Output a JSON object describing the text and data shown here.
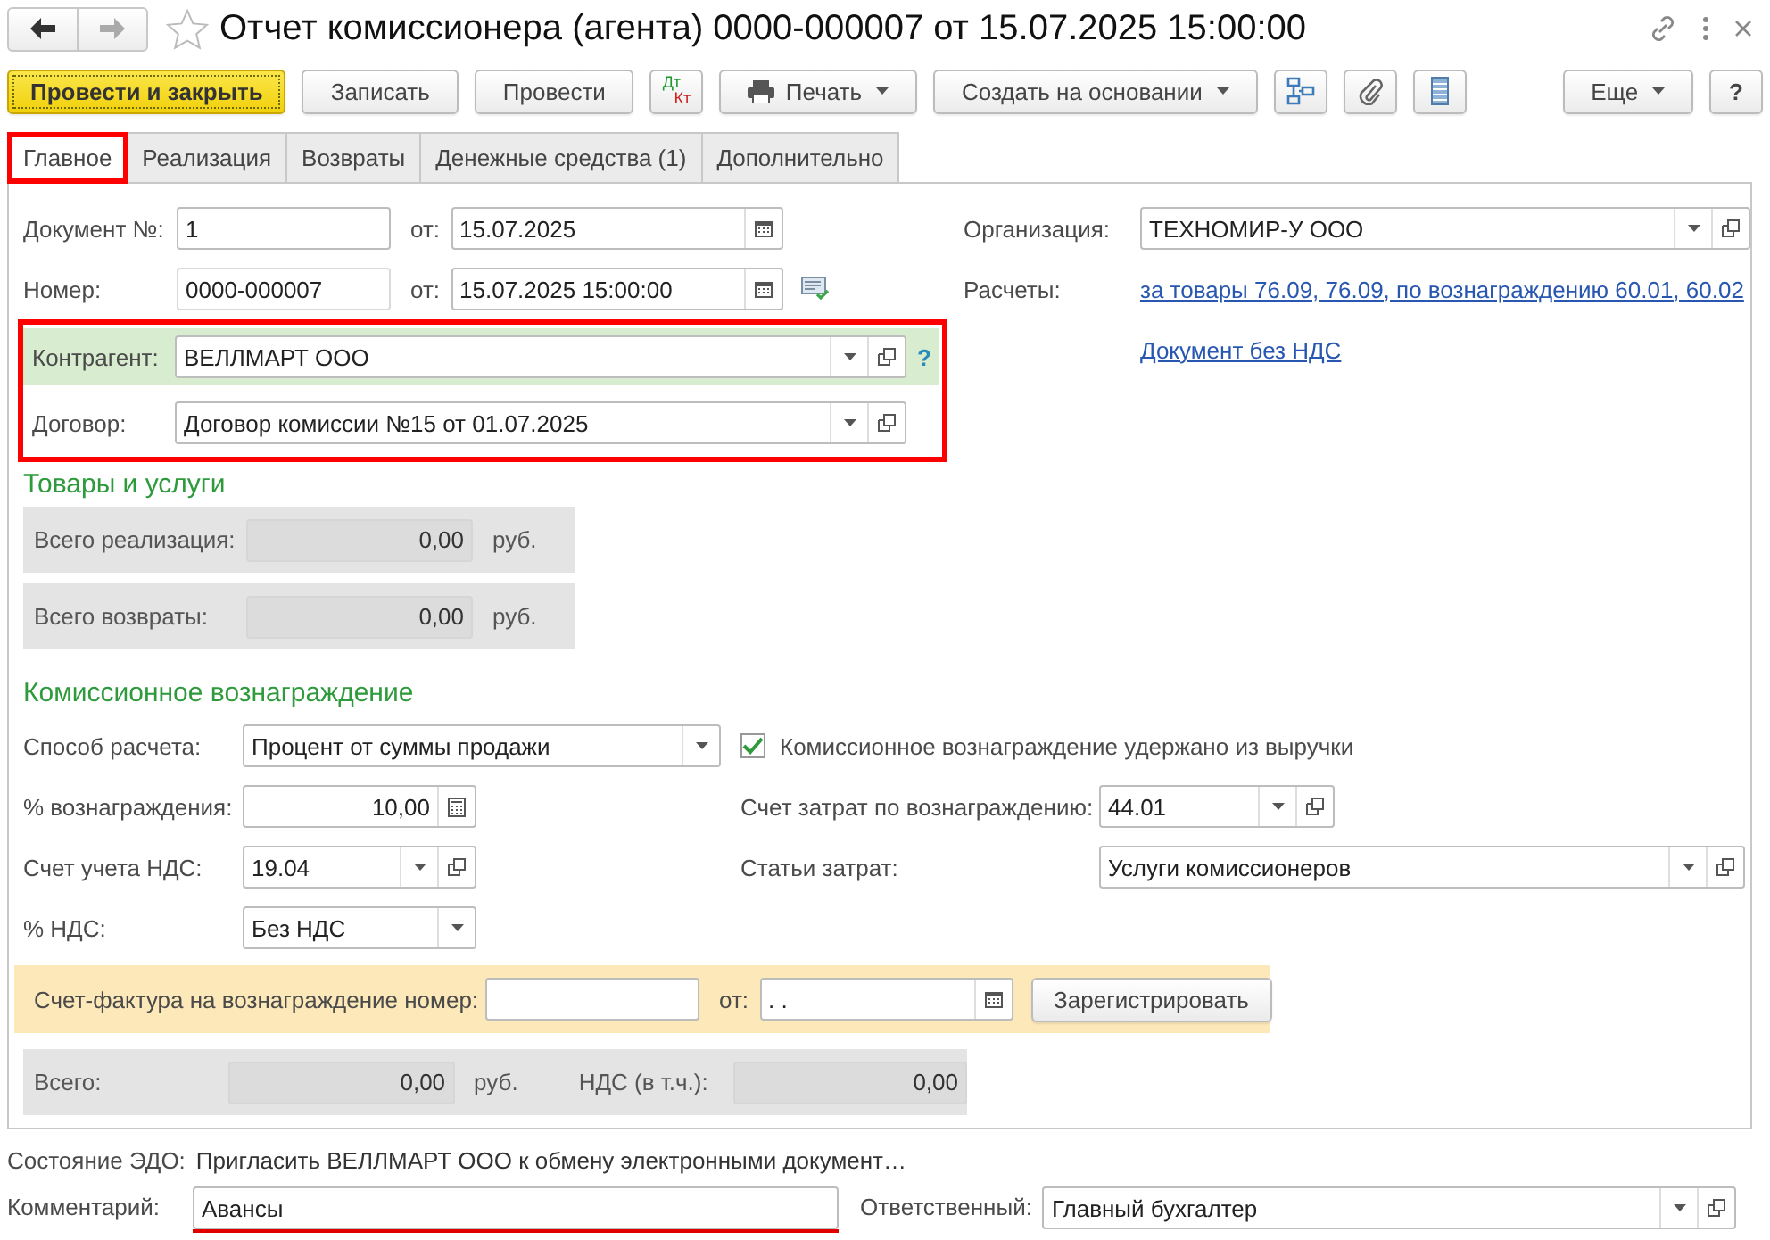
{
  "window": {
    "title": "Отчет комиссионера (агента) 0000-000007 от 15.07.2025 15:00:00",
    "favorite": false
  },
  "toolbar": {
    "left": [
      {
        "kind": "primary",
        "label": "Провести и закрыть"
      },
      {
        "kind": "plain",
        "label": "Записать"
      },
      {
        "kind": "plain",
        "label": "Провести"
      },
      {
        "kind": "dtkt",
        "top": "Дт",
        "bottom": "Кт"
      },
      {
        "kind": "print-menu",
        "label": "Печать"
      },
      {
        "kind": "menu",
        "label": "Создать на основании"
      },
      {
        "kind": "structure"
      },
      {
        "kind": "attach"
      },
      {
        "kind": "report"
      }
    ],
    "right": [
      {
        "kind": "menu",
        "label": "Еще"
      },
      {
        "kind": "plain",
        "label": "?"
      }
    ]
  },
  "tabs": [
    {
      "label": "Главное",
      "selected": true,
      "highlighted": true
    },
    {
      "label": "Реализация",
      "selected": false,
      "highlighted": false
    },
    {
      "label": "Возвраты",
      "selected": false,
      "highlighted": false
    },
    {
      "label": "Денежные средства (1)",
      "selected": false,
      "highlighted": false
    },
    {
      "label": "Дополнительно",
      "selected": false,
      "highlighted": false
    }
  ],
  "header": {
    "doc_number": {
      "label": "Документ №:",
      "value": "1",
      "date_label": "от:",
      "date": {
        "value": "15.07.2025",
        "kind": "date"
      }
    },
    "number": {
      "label": "Номер:",
      "value": "0000-000007",
      "readonly": true,
      "date_label": "от:",
      "date": {
        "value": "15.07.2025 15:00:00",
        "kind": "date"
      }
    },
    "parties": {
      "highlighted": true,
      "counterparty": {
        "label": "Контрагент:",
        "value": "ВЕЛЛМАРТ ООО",
        "kind": "select-open",
        "help": "?"
      },
      "contract": {
        "label": "Договор:",
        "value": "Договор комиссии №15 от 01.07.2025",
        "kind": "select-open"
      }
    },
    "organization": {
      "label": "Организация:",
      "value": "ТЕХНОМИР-У ООО",
      "kind": "select-open"
    },
    "settlements": {
      "label": "Расчеты:",
      "link": "за товары 76.09, 76.09, по вознаграждению 60.01, 60.02"
    },
    "vat_link": "Документ без НДС"
  },
  "goods": {
    "title": "Товары и услуги",
    "rows": [
      {
        "label": "Всего реализация:",
        "value": "0,00",
        "unit": "руб."
      },
      {
        "label": "Всего возвраты:",
        "value": "0,00",
        "unit": "руб."
      }
    ]
  },
  "commission": {
    "title": "Комиссионное вознаграждение",
    "method": {
      "label": "Способ расчета:",
      "value": "Процент от суммы продажи",
      "kind": "select"
    },
    "withheld": {
      "label": "Комиссионное вознаграждение удержано из выручки",
      "checked": true
    },
    "percent": {
      "label": "% вознаграждения:",
      "value": "10,00",
      "kind": "number"
    },
    "cost_account": {
      "label": "Счет затрат по вознаграждению:",
      "value": "44.01",
      "kind": "select-open"
    },
    "vat_account": {
      "label": "Счет учета НДС:",
      "value": "19.04",
      "kind": "select-open"
    },
    "cost_items": {
      "label": "Статьи затрат:",
      "value": "Услуги комиссионеров",
      "kind": "select-open"
    },
    "vat_rate": {
      "label": "% НДС:",
      "value": "Без НДС",
      "kind": "select"
    },
    "invoice": {
      "label": "Счет-фактура на вознаграждение номер:",
      "date_label": "от:",
      "date": {
        "value": ". .",
        "kind": "date"
      },
      "button": "Зарегистрировать"
    },
    "totals": {
      "total_label": "Всего:",
      "total": "0,00",
      "unit": "руб.",
      "vat_label": "НДС (в т.ч.):",
      "vat": "0,00"
    }
  },
  "footer": {
    "edo_label": "Состояние ЭДО:",
    "edo_text": "Пригласить ВЕЛЛМАРТ ООО к обмену электронными документ…",
    "comment": {
      "label": "Комментарий:",
      "value": "Авансы",
      "highlighted": true
    },
    "responsible": {
      "label": "Ответственный:",
      "value": "Главный бухгалтер",
      "kind": "select-open"
    }
  }
}
